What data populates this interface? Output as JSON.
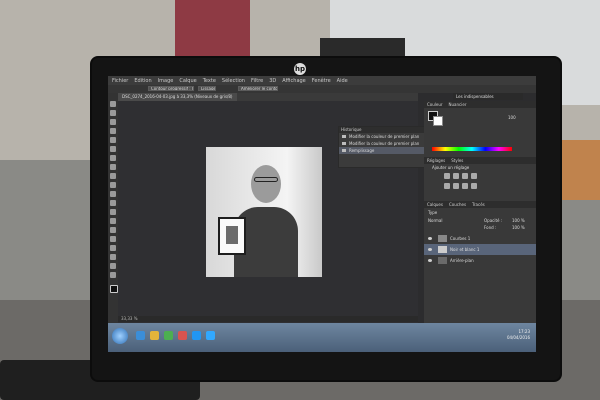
{
  "app": {
    "menu": [
      "Fichier",
      "Edition",
      "Image",
      "Calque",
      "Texte",
      "Sélection",
      "Filtre",
      "3D",
      "Affichage",
      "Fenêtre",
      "Aide"
    ],
    "options_bar": {
      "field1": "Contour progressif : 0 px",
      "field2": "Lissage",
      "button": "Améliorer le contour..."
    },
    "document_tab": "DSC_0274_2016-04-03.jpg à 33,3% (Niveaux de gris/8)",
    "workspace_button": "Les indispensables"
  },
  "history_panel": {
    "title": "Historique",
    "items": [
      "Modifier la couleur de premier plan",
      "Modifier la couleur de premier plan",
      "Remplissage"
    ]
  },
  "color_panel": {
    "tabs": [
      "Couleur",
      "Nuancier"
    ],
    "value": "100"
  },
  "adjustments_panel": {
    "tabs": [
      "Réglages",
      "Styles"
    ],
    "title": "Ajouter un réglage"
  },
  "layers_panel": {
    "tabs": [
      "Calques",
      "Couches",
      "Tracés"
    ],
    "search_label": "Type",
    "mode": "Normal",
    "opacity_label": "Opacité :",
    "opacity": "100 %",
    "fill_label": "Fond :",
    "fill": "100 %",
    "layers": [
      {
        "name": "Courbes 1",
        "selected": false
      },
      {
        "name": "Noir et blanc 1",
        "selected": true
      },
      {
        "name": "Arrière-plan",
        "selected": false
      }
    ]
  },
  "status": {
    "zoom": "33,33 %"
  },
  "taskbar": {
    "time": "17:23",
    "date": "04/04/2016"
  },
  "monitor": {
    "brand_logo": "hp"
  }
}
